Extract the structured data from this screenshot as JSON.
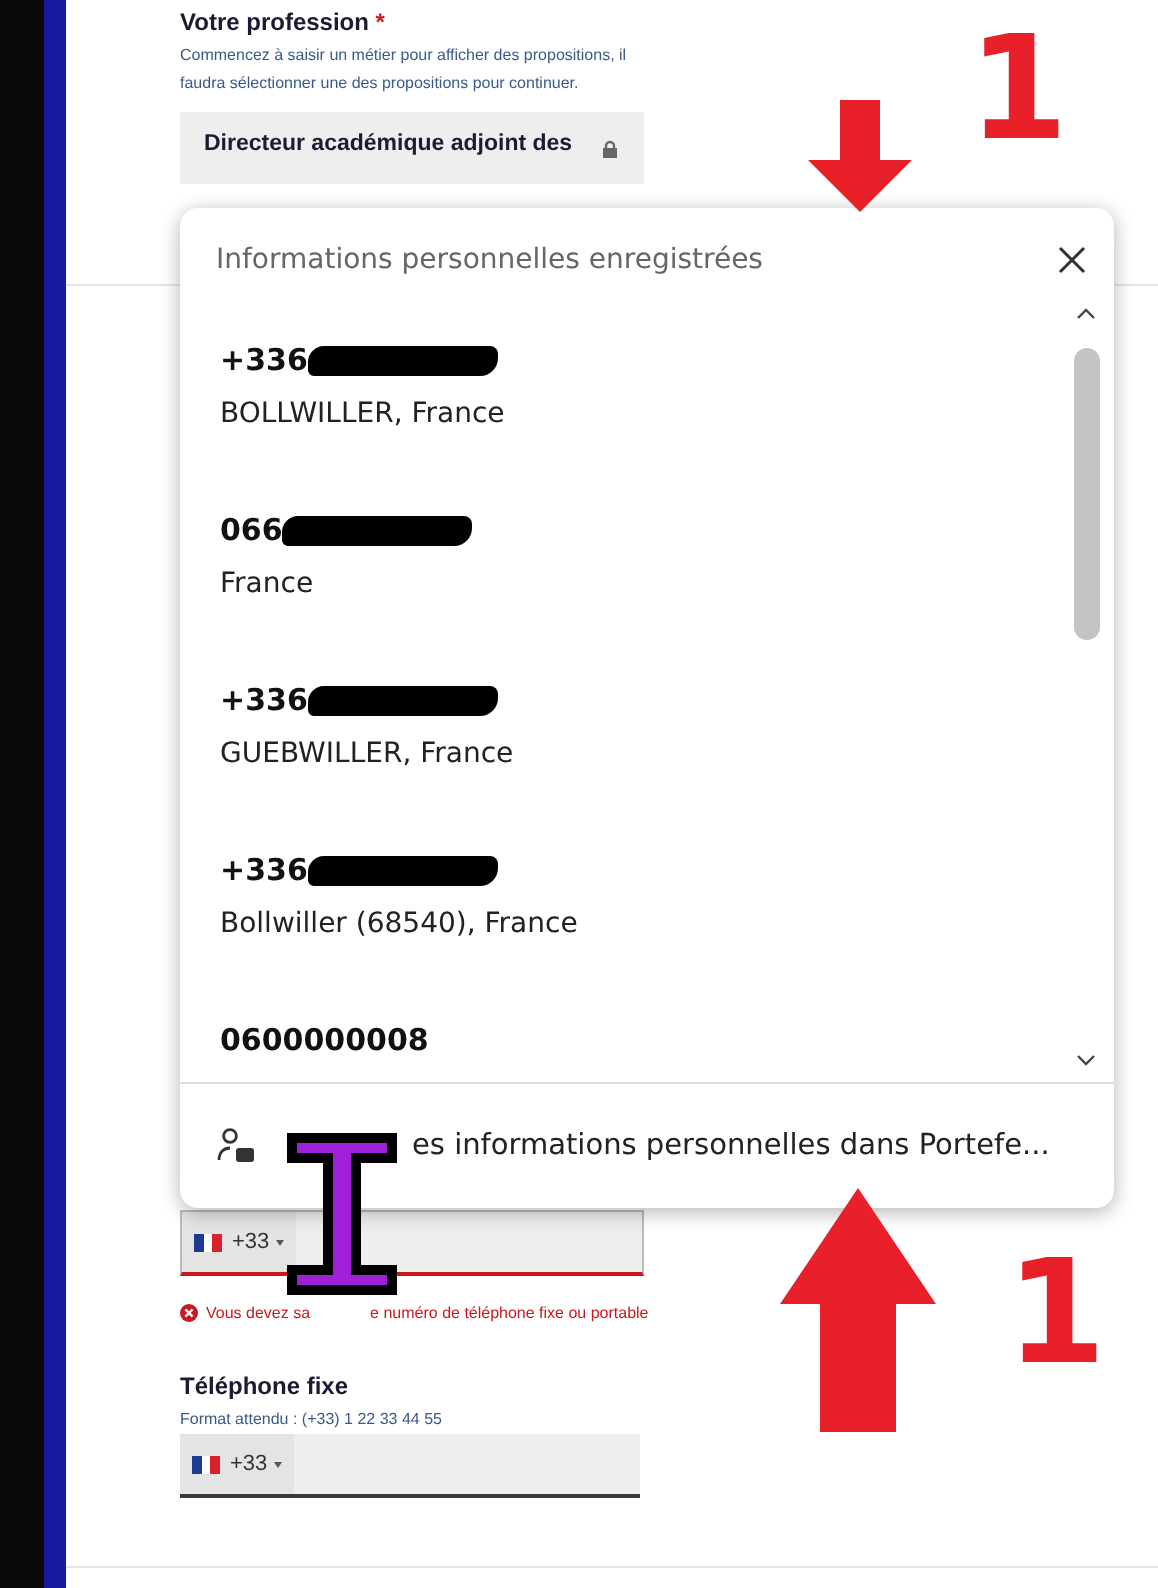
{
  "form": {
    "profession": {
      "label": "Votre profession",
      "required_mark": "*",
      "hint": "Commencez à saisir un métier pour afficher des propositions, il faudra sélectionner une des propositions pour continuer.",
      "value": "Directeur académique adjoint des"
    },
    "mobile": {
      "country_code": "+33",
      "invalid": true,
      "error_parts": [
        "Vous devez sa",
        "e numéro de téléphone fixe ou portable"
      ]
    },
    "landline": {
      "label": "Téléphone fixe",
      "hint": "Format attendu : (+33) 1 22 33 44 55",
      "country_code": "+33"
    }
  },
  "popup": {
    "title": "Informations personnelles enregistrées",
    "entries": [
      {
        "phone": "+336",
        "redacted": true,
        "address": "BOLLWILLER, France"
      },
      {
        "phone": "066",
        "redacted": true,
        "address": "France"
      },
      {
        "phone": "+336",
        "redacted": true,
        "address": "GUEBWILLER, France"
      },
      {
        "phone": "+336",
        "redacted": true,
        "address": "Bollwiller (68540), France"
      },
      {
        "phone": "0600000008",
        "redacted": false
      }
    ],
    "footer": "es informations personnelles dans Portefe..."
  },
  "annotations": [
    {
      "kind": "arrow_down",
      "label": "1"
    },
    {
      "kind": "arrow_up",
      "label": "1"
    }
  ]
}
